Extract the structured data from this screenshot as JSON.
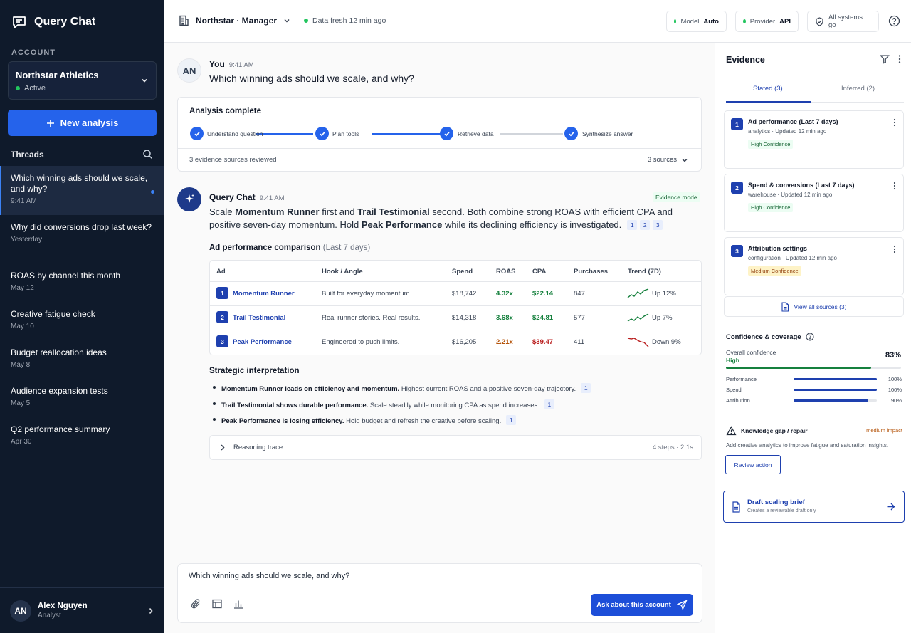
{
  "app": {
    "title": "Query Chat"
  },
  "sidebar": {
    "account_label": "ACCOUNT",
    "account": {
      "name": "Northstar Athletics",
      "status": "Active"
    },
    "new_analysis": "New analysis",
    "threads_label": "Threads",
    "threads": [
      {
        "title": "Which winning ads should we scale, and why?",
        "date": "9:41 AM",
        "active": true
      },
      {
        "title": "Why did conversions drop last week?",
        "date": "Yesterday"
      },
      {
        "title": "ROAS by channel this month",
        "date": "May 12"
      },
      {
        "title": "Creative fatigue check",
        "date": "May 10"
      },
      {
        "title": "Budget reallocation ideas",
        "date": "May 8"
      },
      {
        "title": "Audience expansion tests",
        "date": "May 5"
      },
      {
        "title": "Q2 performance summary",
        "date": "Apr 30"
      }
    ],
    "user": {
      "initials": "AN",
      "name": "Alex Nguyen",
      "role": "Analyst"
    }
  },
  "topbar": {
    "org": "Northstar · Manager",
    "freshness": "Data fresh 12 min ago",
    "model_label": "Model",
    "model_value": "Auto",
    "provider_label": "Provider",
    "provider_value": "API",
    "systems": "All systems go"
  },
  "conversation": {
    "user_initials": "AN",
    "user_name": "You",
    "user_time": "9:41 AM",
    "question": "Which winning ads should we scale, and why?",
    "analysis": {
      "title": "Analysis complete",
      "steps": [
        "Understand question",
        "Plan tools",
        "Retrieve data",
        "Synthesize answer"
      ],
      "evidence_count": "3 evidence sources reviewed",
      "sources": "3 sources"
    },
    "bot_name": "Query Chat",
    "bot_time": "9:41 AM",
    "mode": "Evidence mode",
    "answer": {
      "p1": "Scale ",
      "b1": "Momentum Runner",
      "p2": " first and ",
      "b2": "Trail Testimonial",
      "p3": " second. Both combine strong ROAS with efficient CPA and positive seven-day momentum. Hold ",
      "b3": "Peak Performance",
      "p4": " while its declining efficiency is investigated.",
      "citations": [
        "1",
        "2",
        "3"
      ]
    },
    "table": {
      "title": "Ad performance comparison",
      "period": "(Last 7 days)",
      "headers": [
        "Ad",
        "Hook / Angle",
        "Spend",
        "ROAS",
        "CPA",
        "Purchases",
        "Trend (7D)"
      ],
      "rows": [
        {
          "n": "1",
          "ad": "Momentum Runner",
          "hook": "Built for everyday momentum.",
          "spend": "$18,742",
          "roas": "4.32x",
          "cpa": "$22.14",
          "purchases": "847",
          "trend": "Up 12%",
          "trend_dir": "up"
        },
        {
          "n": "2",
          "ad": "Trail Testimonial",
          "hook": "Real runner stories. Real results.",
          "spend": "$14,318",
          "roas": "3.68x",
          "cpa": "$24.81",
          "purchases": "577",
          "trend": "Up 7%",
          "trend_dir": "up"
        },
        {
          "n": "3",
          "ad": "Peak Performance",
          "hook": "Engineered to push limits.",
          "spend": "$16,205",
          "roas": "2.21x",
          "cpa": "$39.47",
          "purchases": "411",
          "trend": "Down 9%",
          "trend_dir": "down"
        }
      ]
    },
    "strategy": {
      "title": "Strategic interpretation",
      "items": [
        {
          "bold": "Momentum Runner leads on efficiency and momentum.",
          "text": " Highest current ROAS and a positive seven-day trajectory.",
          "cite": "1"
        },
        {
          "bold": "Trail Testimonial shows durable performance.",
          "text": " Scale steadily while monitoring CPA as spend increases.",
          "cite": "1"
        },
        {
          "bold": "Peak Performance is losing efficiency.",
          "text": " Hold budget and refresh the creative before scaling.",
          "cite": "1"
        }
      ]
    },
    "trace": {
      "label": "Reasoning trace",
      "meta": "4 steps · 2.1s"
    }
  },
  "composer": {
    "text": "Which winning ads should we scale, and why?",
    "ask_label": "Ask about this account"
  },
  "evidence": {
    "title": "Evidence",
    "tabs": [
      "Stated (3)",
      "Inferred (2)"
    ],
    "sources": [
      {
        "n": "1",
        "title": "Ad performance (Last 7 days)",
        "sub": "analytics · Updated 12 min ago",
        "confidence": "High Confidence",
        "level": "high"
      },
      {
        "n": "2",
        "title": "Spend & conversions (Last 7 days)",
        "sub": "warehouse · Updated 12 min ago",
        "confidence": "High Confidence",
        "level": "high"
      },
      {
        "n": "3",
        "title": "Attribution settings",
        "sub": "configuration · Updated 12 min ago",
        "confidence": "Medium Confidence",
        "level": "medium"
      }
    ],
    "view_all": "View all sources (3)",
    "coverage": {
      "title": "Confidence & coverage",
      "overall_label": "Overall confidence",
      "overall_level": "High",
      "overall_pct": "83%",
      "overall_value": 0.83,
      "metrics": [
        {
          "label": "Performance",
          "pct": "100%",
          "value": 1.0
        },
        {
          "label": "Spend",
          "pct": "100%",
          "value": 1.0
        },
        {
          "label": "Attribution",
          "pct": "90%",
          "value": 0.9
        }
      ]
    },
    "gap": {
      "title": "Knowledge gap / repair",
      "impact": "medium impact",
      "desc": "Add creative analytics to improve fatigue and saturation insights.",
      "action": "Review action"
    },
    "draft": {
      "title": "Draft scaling brief",
      "sub": "Creates a reviewable draft only"
    }
  },
  "colors": {
    "accent": "#2563eb",
    "navy": "#0f1a2b",
    "positive": "#15803d",
    "negative": "#b91c1c",
    "warning": "#b45309"
  }
}
